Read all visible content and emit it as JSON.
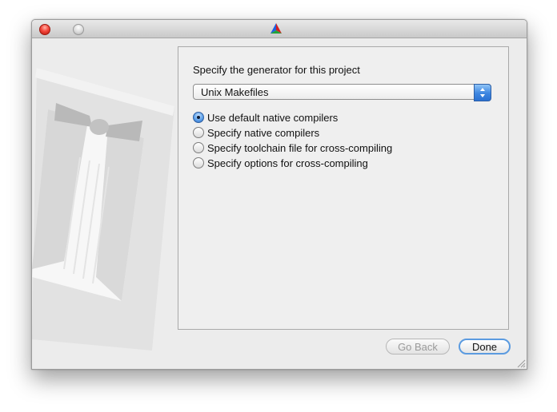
{
  "window": {
    "title": "",
    "app_icon": "cmake-triangle-icon"
  },
  "generator": {
    "prompt": "Specify the generator for this project",
    "selected": "Unix Makefiles"
  },
  "options": [
    {
      "label": "Use default native compilers",
      "checked": true
    },
    {
      "label": "Specify native compilers",
      "checked": false
    },
    {
      "label": "Specify toolchain file for cross-compiling",
      "checked": false
    },
    {
      "label": "Specify options for cross-compiling",
      "checked": false
    }
  ],
  "buttons": {
    "back": "Go Back",
    "done": "Done"
  },
  "colors": {
    "accent": "#3d86e0",
    "close": "#f5473c"
  }
}
